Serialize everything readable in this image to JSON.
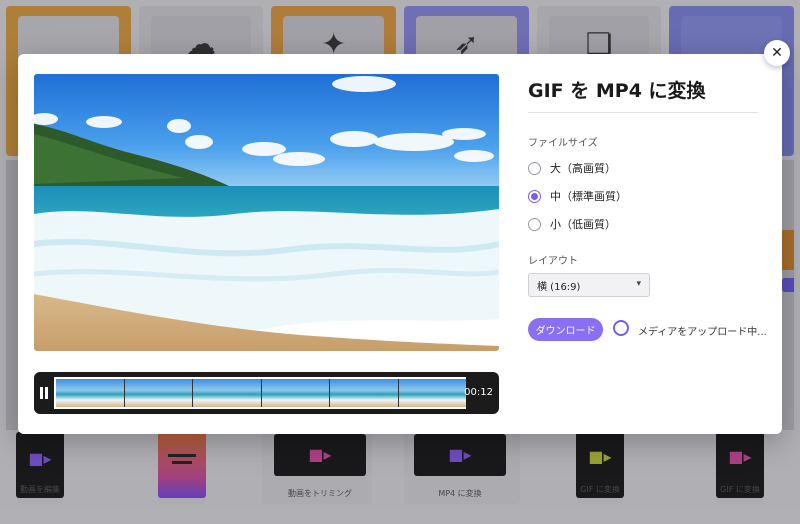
{
  "modal": {
    "title": "GIF を MP4 に変換",
    "close_icon": "close-icon",
    "file_size": {
      "label": "ファイルサイズ",
      "options": [
        {
          "label": "大（高画質）",
          "selected": false
        },
        {
          "label": "中（標準画質）",
          "selected": true
        },
        {
          "label": "小（低画質）",
          "selected": false
        }
      ]
    },
    "layout": {
      "label": "レイアウト",
      "selected": "横 (16:9)"
    },
    "download_label": "ダウンロード",
    "upload_status": "メディアをアップロード中...",
    "timeline": {
      "time": "00:12",
      "pause_icon": "pause-icon"
    }
  },
  "background": {
    "top_icons": [
      "cloud-icon",
      "sparkle-image-icon",
      "rocket-icon",
      "document-icon"
    ],
    "bottom_tiles": [
      {
        "label": "動画を編集"
      },
      {
        "label": "動画をトリミング"
      },
      {
        "label": "MP4 に変換"
      },
      {
        "label": "GIF に変換"
      },
      {
        "label": "GIF に変換"
      }
    ]
  },
  "colors": {
    "accent": "#7a5cf0",
    "button": "#8a6ff2"
  }
}
